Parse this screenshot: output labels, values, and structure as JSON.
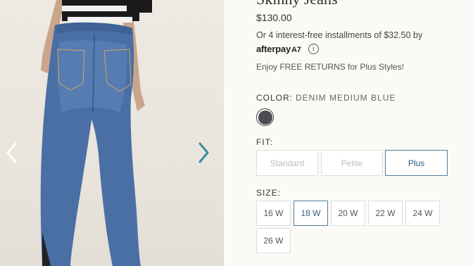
{
  "product": {
    "title": "Skinny Jeans",
    "price": "$130.00",
    "installments": "Or 4 interest-free installments of $32.50 by",
    "afterpay_logo": "afterpay",
    "afterpay_mark": "A7",
    "info_icon": "ⓘ",
    "free_returns": "Enjoy FREE RETURNS for Plus Styles!"
  },
  "color": {
    "label": "COLOR:",
    "value": "DENIM MEDIUM BLUE",
    "swatch_color": "#4b4d52"
  },
  "fit": {
    "label": "FIT:",
    "options": [
      {
        "label": "Standard",
        "state": "disabled"
      },
      {
        "label": "Petite",
        "state": "disabled"
      },
      {
        "label": "Plus",
        "state": "selected"
      }
    ]
  },
  "size": {
    "label": "SIZE:",
    "options": [
      {
        "label": "16 W",
        "state": "available"
      },
      {
        "label": "18 W",
        "state": "selected"
      },
      {
        "label": "20 W",
        "state": "available"
      },
      {
        "label": "22 W",
        "state": "available"
      },
      {
        "label": "24 W",
        "state": "available"
      },
      {
        "label": "26 W",
        "state": "available"
      }
    ]
  },
  "gallery": {
    "prev_icon": "chevron-left-icon",
    "next_icon": "chevron-right-icon",
    "accent": "#3d8a9a"
  }
}
